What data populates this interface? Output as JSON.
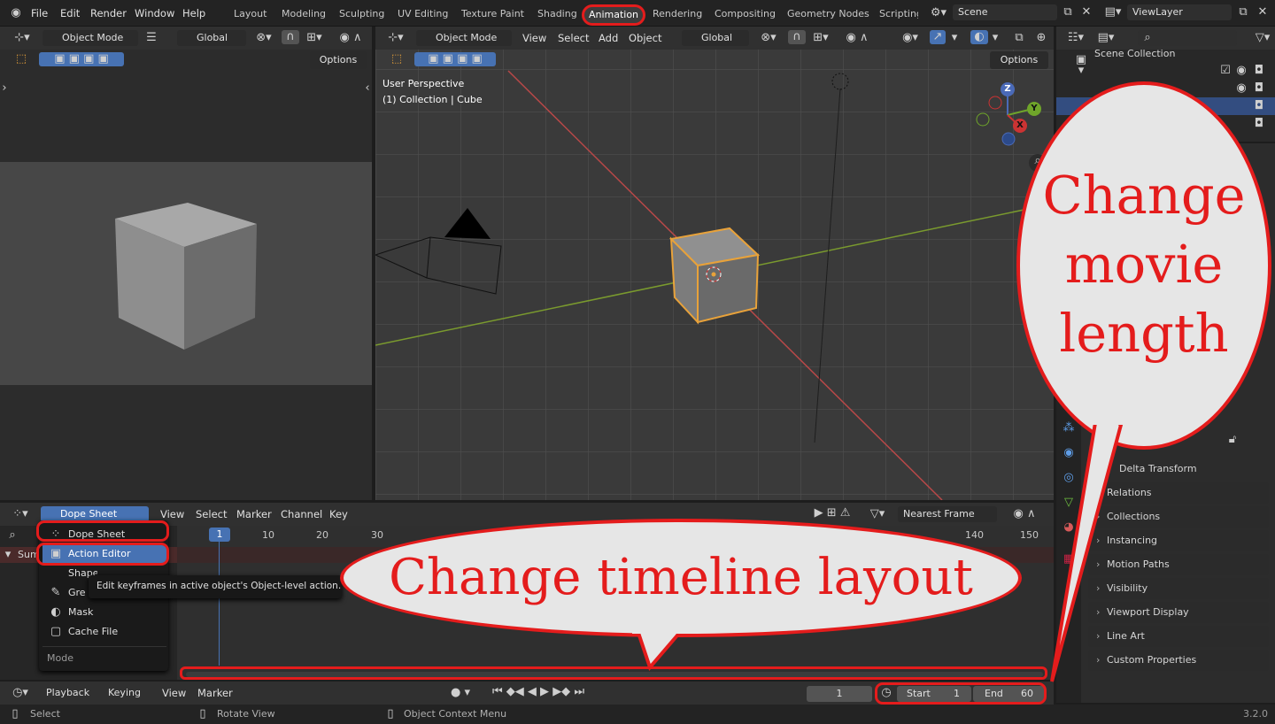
{
  "topmenu": {
    "file": "File",
    "edit": "Edit",
    "render": "Render",
    "window": "Window",
    "help": "Help"
  },
  "workspaces": [
    "Layout",
    "Modeling",
    "Sculpting",
    "UV Editing",
    "Texture Paint",
    "Shading",
    "Animation",
    "Rendering",
    "Compositing",
    "Geometry Nodes",
    "Scripting"
  ],
  "scene": "Scene",
  "viewlayer": "ViewLayer",
  "left_header": {
    "mode": "Object Mode",
    "orient": "Global",
    "options": "Options"
  },
  "viewport": {
    "mode": "Object Mode",
    "view": "View",
    "select": "Select",
    "add": "Add",
    "object": "Object",
    "orient": "Global",
    "options": "Options",
    "perspective": "User Perspective",
    "context": "(1) Collection | Cube"
  },
  "gizmo": {
    "z": "Z",
    "y": "Y",
    "x": "X"
  },
  "outliner": {
    "title": "Scene Collection"
  },
  "properties": {
    "delta": "Delta Transform",
    "rows": [
      "Relations",
      "Collections",
      "Instancing",
      "Motion Paths",
      "Visibility",
      "Viewport Display",
      "Line Art",
      "Custom Properties"
    ]
  },
  "dopesheet": {
    "mode": "Dope Sheet",
    "view": "View",
    "select": "Select",
    "marker": "Marker",
    "channel": "Channel",
    "key": "Key",
    "snap": "Nearest Frame",
    "summary": "Sum",
    "frame_ticks": [
      "1",
      "10",
      "20",
      "30",
      "140",
      "150"
    ]
  },
  "mode_menu": {
    "items": [
      "Dope Sheet",
      "Action Editor",
      "Shape Key Editor",
      "Grease Pencil",
      "Mask",
      "Cache File"
    ],
    "tooltip": "Edit keyframes in active object's Object-level action.",
    "footer": "Mode"
  },
  "timeline": {
    "playback": "Playback",
    "keying": "Keying",
    "view": "View",
    "marker": "Marker",
    "current": "1",
    "start_label": "Start",
    "start": "1",
    "end_label": "End",
    "end": "60"
  },
  "status": {
    "select": "Select",
    "rotate": "Rotate View",
    "context": "Object Context Menu",
    "version": "3.2.0"
  },
  "callouts": {
    "movie": [
      "Change",
      "movie",
      "length"
    ],
    "timeline": "Change timeline layout"
  },
  "colors": {
    "accent": "#4772b3",
    "highlight": "#e41c1c",
    "selected": "#e8a23a"
  }
}
